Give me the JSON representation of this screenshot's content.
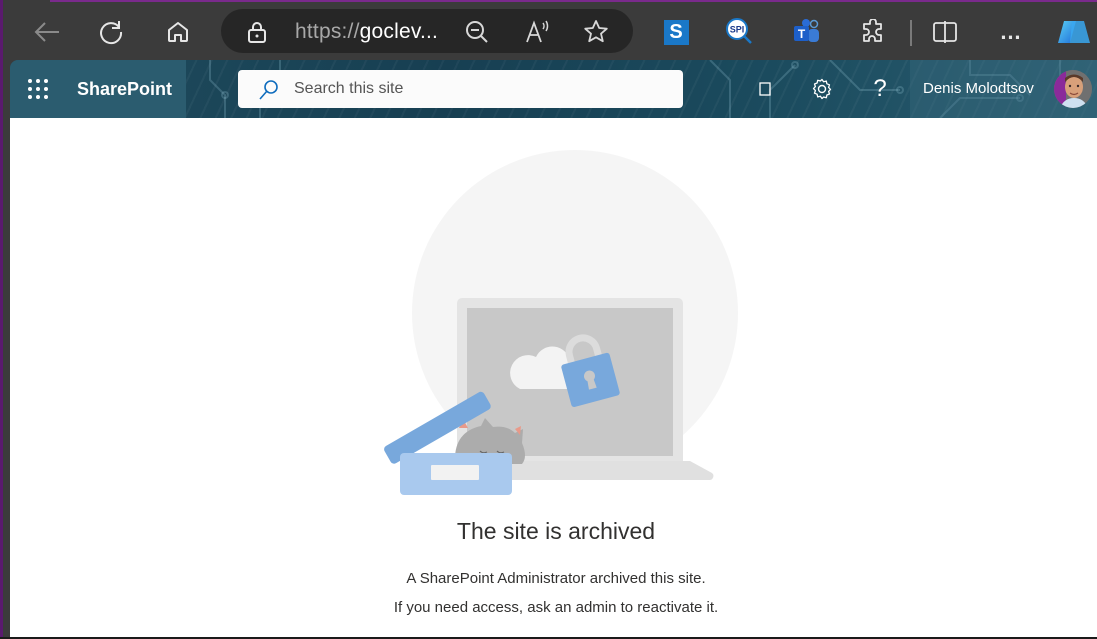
{
  "browser": {
    "url_prefix": "https://",
    "url_host": "goclev...",
    "icons": {
      "back": "arrow-left-icon",
      "refresh": "refresh-icon",
      "home": "home-icon",
      "lock": "lock-icon",
      "zoom": "zoom-out-icon",
      "read_aloud": "read-aloud-icon",
      "favorite": "star-icon",
      "ext1": "s-extension-icon",
      "ext2": "spi-extension-icon",
      "ext3": "teams-icon",
      "extensions": "puzzle-icon",
      "split": "split-screen-icon",
      "more": "more-icon",
      "copilot": "copilot-icon"
    },
    "ext_s_label": "S",
    "ext_spi_label": "SPI",
    "teams_label": "T",
    "more_label": "…"
  },
  "suite_bar": {
    "app_name": "SharePoint",
    "search_placeholder": "Search this site",
    "user_name": "Denis Molodtsov",
    "help_label": "?",
    "colors": {
      "brand_block": "#2b5c6f",
      "search_icon": "#0f6cbd"
    }
  },
  "main": {
    "title": "The site is archived",
    "message_line1": "A SharePoint Administrator archived this site.",
    "message_line2": "If you need access, ask an admin to reactivate it.",
    "illustration_colors": {
      "circle": "#f5f5f5",
      "laptop_frame": "#e4e4e4",
      "laptop_screen": "#c8c8c8",
      "lock": "#78a8dc",
      "box_lid": "#78a8dc",
      "box": "#a9c9ee",
      "cat": "#acacac"
    }
  }
}
